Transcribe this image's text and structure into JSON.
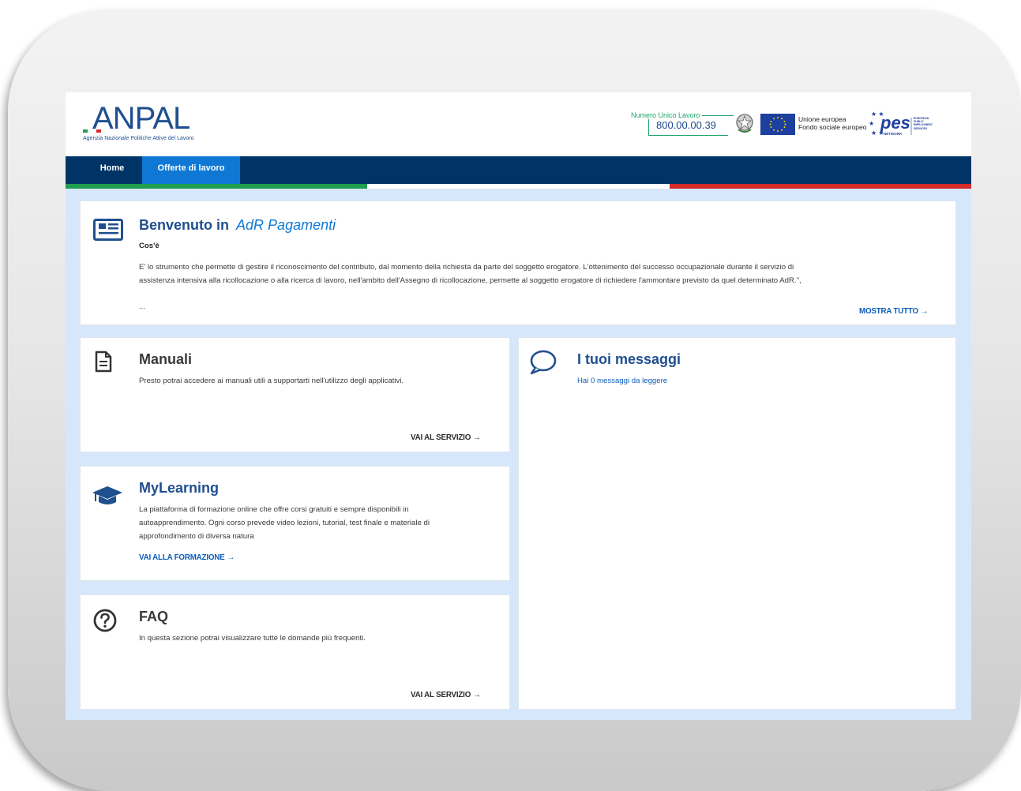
{
  "header": {
    "logo_text": "ANPAL",
    "logo_tagline": "Agenzia Nazionale Politiche Attive del Lavoro",
    "hotline_label": "Numero Unico Lavoro",
    "hotline_number": "800.00.00.39",
    "eu_line1": "Unione europea",
    "eu_line2": "Fondo sociale europeo",
    "pes_logo_text": "pes",
    "pes_network_text": "NETWORK",
    "pes_side_text": "EUROPEAN PUBLIC EMPLOYMENT SERVICES"
  },
  "nav": {
    "items": [
      {
        "label": "Home"
      },
      {
        "label": "Offerte di lavoro",
        "active": true
      }
    ]
  },
  "welcome": {
    "title_prefix": "Benvenuto in",
    "title_app": "AdR Pagamenti",
    "subtitle": "Cos'è",
    "text_line1": "E' lo strumento che permette di gestire il riconoscimento del contributo, dal momento della richiesta da parte del soggetto erogatore. L'ottenimento del successo occupazionale durante il servizio di",
    "text_line2": "assistenza intensiva alla ricollocazione o alla ricerca di lavoro, nell'ambito dell'Assegno di ricollocazione, permette al soggetto erogatore di richiedere l'ammontare previsto da quel determinato AdR.\",",
    "ellipsis": "...",
    "link": "MOSTRA TUTTO",
    "icon": "newspaper-icon"
  },
  "manuali": {
    "title": "Manuali",
    "text": "Presto potrai accedere ai manuali utili a supportarti nell'utilizzo degli applicativi.",
    "link": "VAI AL SERVIZIO",
    "icon": "document-icon"
  },
  "messaggi": {
    "title": "I tuoi messaggi",
    "text": "Hai 0 messaggi da leggere",
    "icon": "chat-bubble-icon"
  },
  "mylearning": {
    "title": "MyLearning",
    "text_line1": "La piattaforma di formazione online che offre corsi gratuiti e sempre disponibili in",
    "text_line2": "autoapprendimento. Ogni corso prevede video lezioni, tutorial, test finale e materiale di",
    "text_line3": "approfondimento di diversa natura",
    "link": "VAI ALLA FORMAZIONE",
    "icon": "graduation-cap-icon"
  },
  "faq": {
    "title": "FAQ",
    "text": "In questa sezione potrai visualizzare tutte le domande più frequenti.",
    "link": "VAI AL SERVIZIO",
    "icon": "question-circle-icon"
  },
  "colors": {
    "navy": "#003466",
    "accent_blue": "#0e78d4",
    "page_background": "#d6e7fb",
    "link_blue": "#0b5cb8",
    "italy_green": "#1f9e4f",
    "italy_red": "#d52b2b",
    "hotline_green": "#1ea36b"
  }
}
